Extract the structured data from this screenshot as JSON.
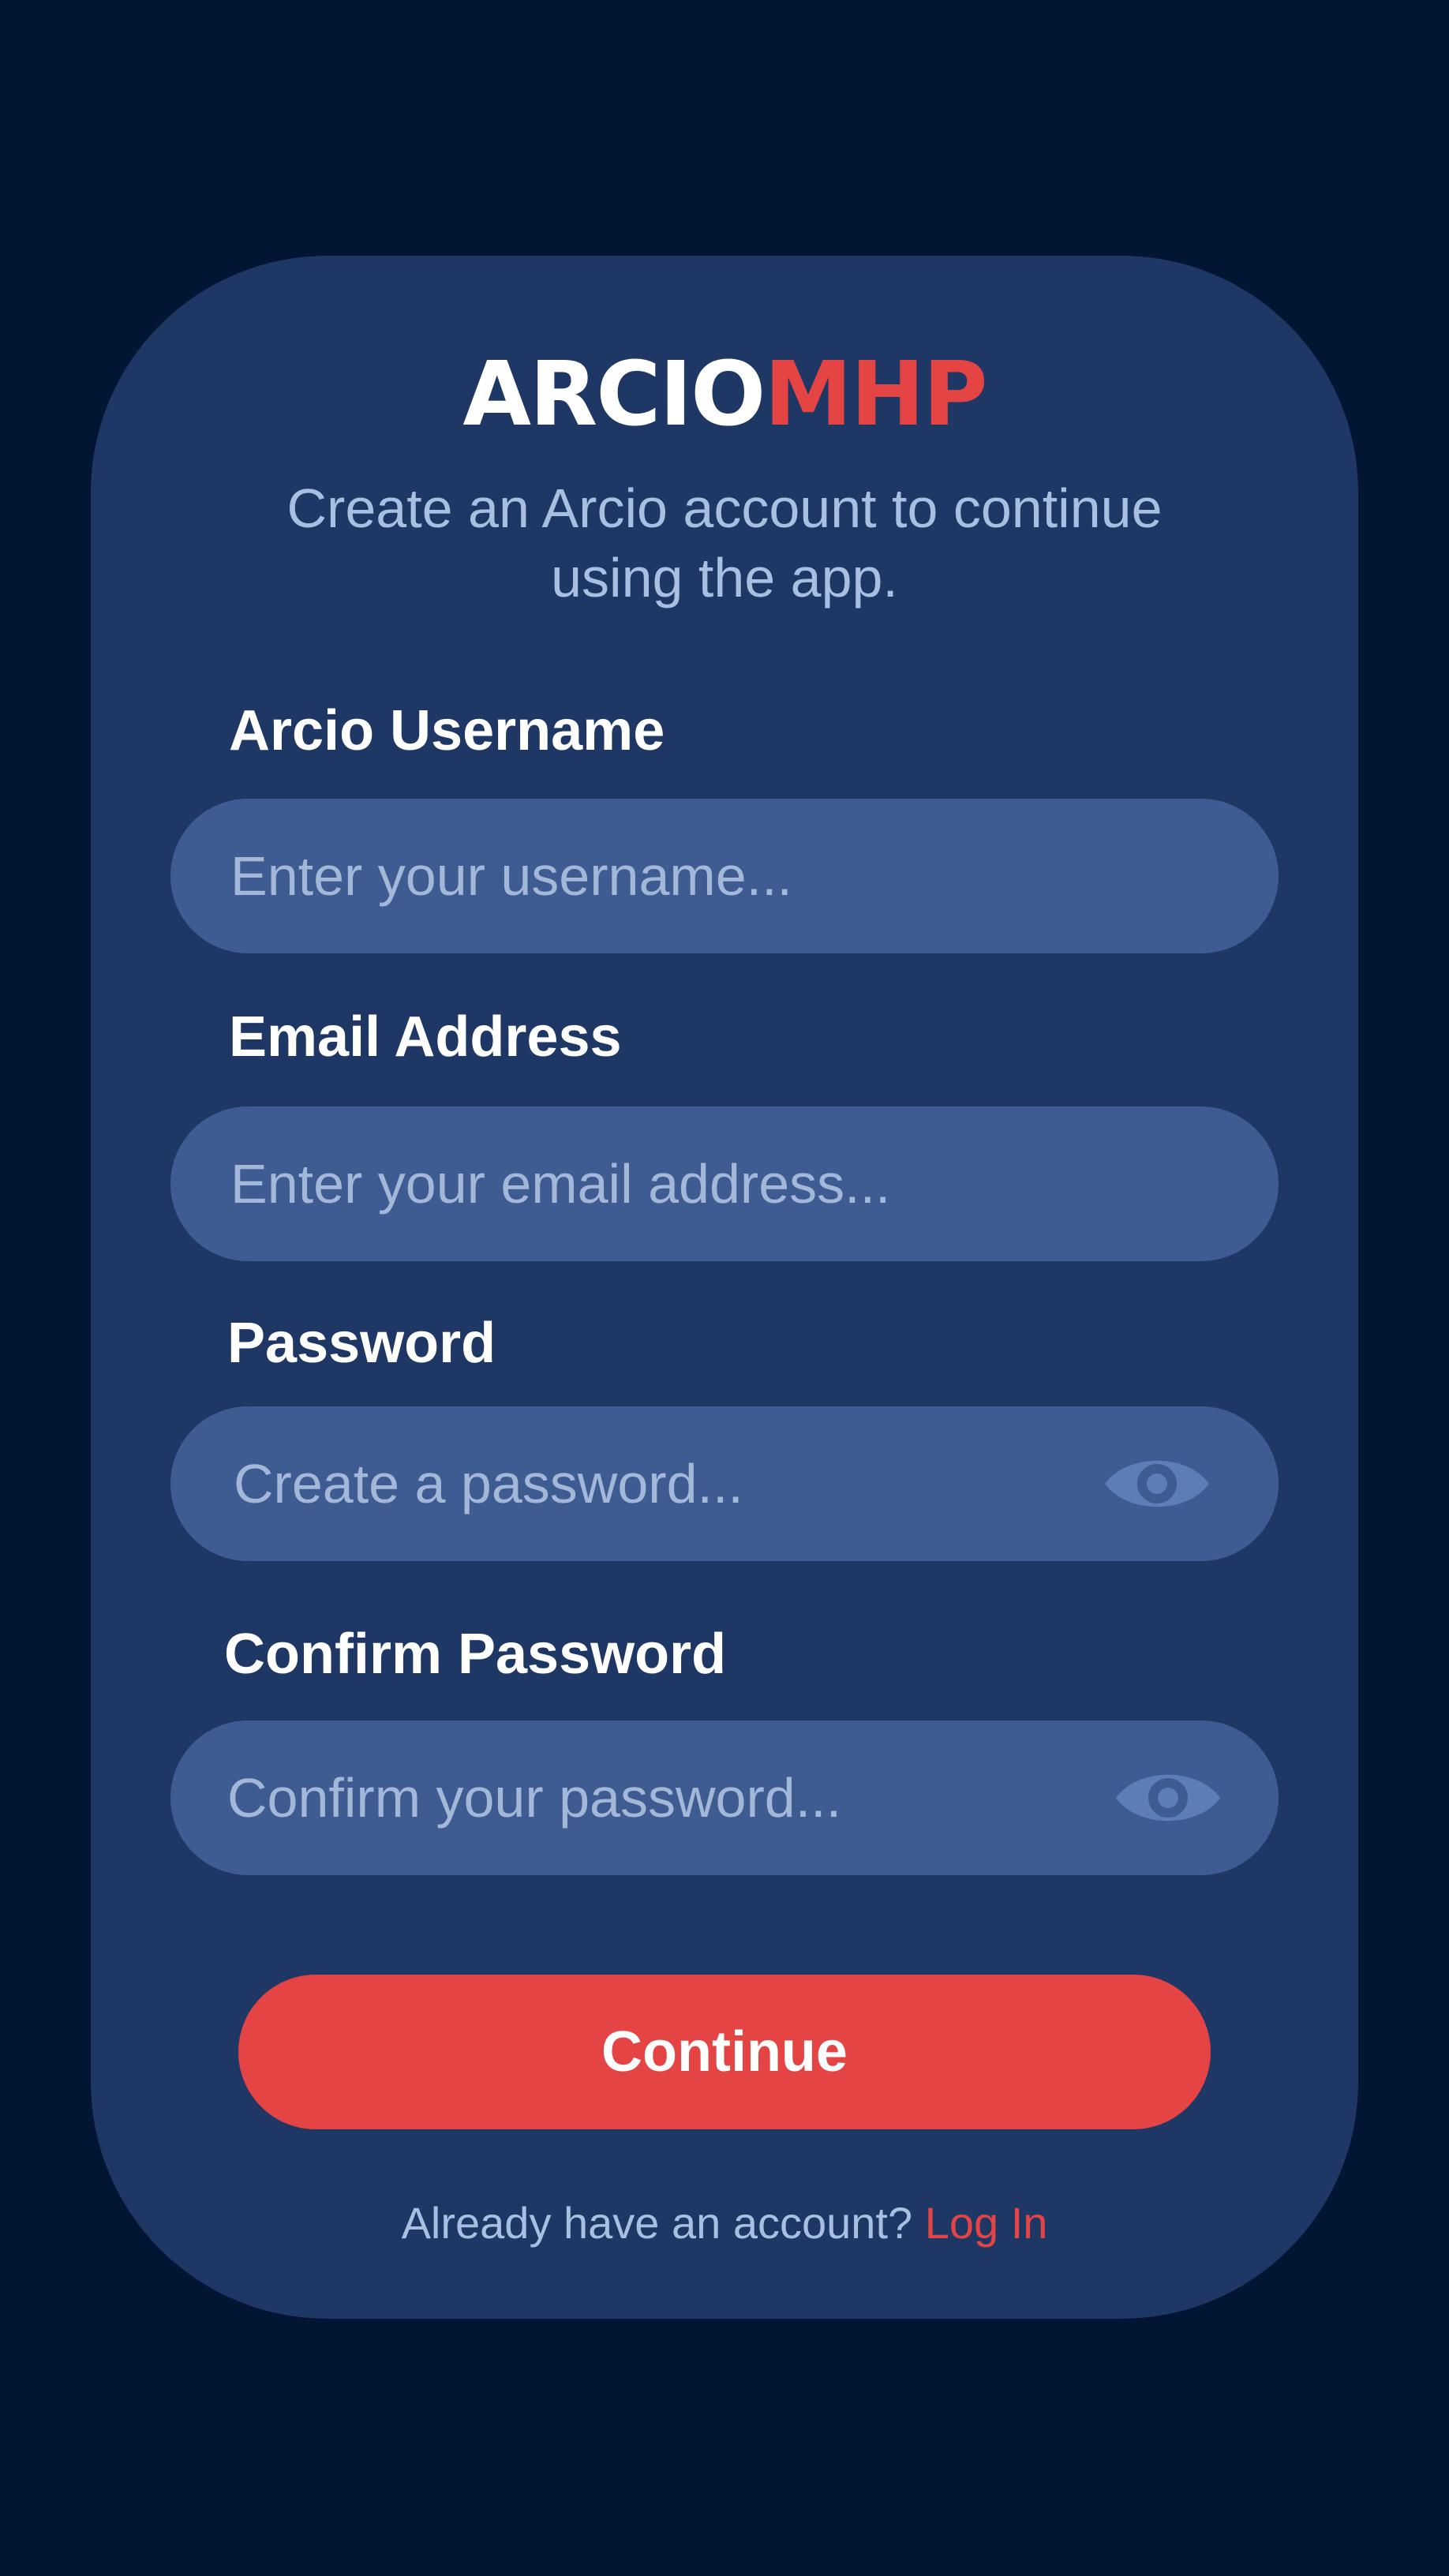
{
  "brand": {
    "logo_primary": "ARCIO",
    "logo_secondary": "MHP",
    "primary_color": "#ffffff",
    "accent_color": "#e54444"
  },
  "intro": {
    "subtitle": "Create an Arcio account to continue using the app."
  },
  "form": {
    "username": {
      "label": "Arcio Username",
      "placeholder": "Enter your username..."
    },
    "email": {
      "label": "Email Address",
      "placeholder": "Enter your email address..."
    },
    "password": {
      "label": "Password",
      "placeholder": "Create a password...",
      "toggle_icon": "eye-icon"
    },
    "confirm_password": {
      "label": "Confirm Password",
      "placeholder": "Confirm your password...",
      "toggle_icon": "eye-icon"
    },
    "submit_label": "Continue"
  },
  "footer": {
    "prompt": "Already have an account?",
    "link_label": "Log In"
  },
  "colors": {
    "background": "#021533",
    "card": "#1e3764",
    "field": "#3e5c91",
    "button": "#e54444"
  }
}
